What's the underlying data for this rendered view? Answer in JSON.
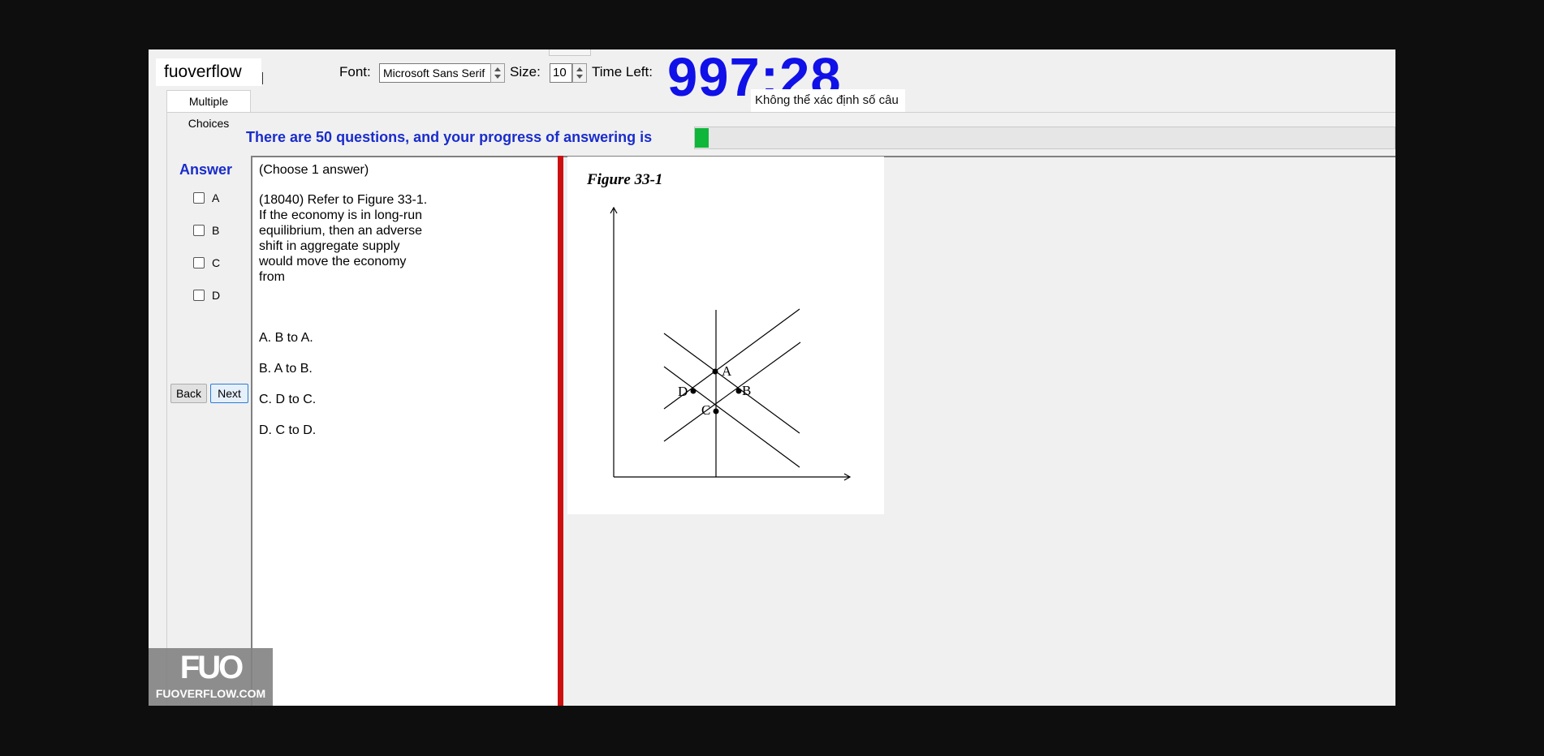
{
  "app": {
    "username": "fuoverflow",
    "font_label": "Font:",
    "font_value": "Microsoft Sans Serif",
    "size_label": "Size:",
    "size_value": "10",
    "time_left_label": "Time Left:",
    "timer": "997:28",
    "status_text": "Không thể xác định số câu"
  },
  "tabs": [
    {
      "label": "Multiple Choices",
      "active": true
    }
  ],
  "progress": {
    "text": "There are 50 questions, and your progress of answering is",
    "fraction": 0.02,
    "color": "#0eb63a"
  },
  "answer": {
    "title": "Answer",
    "options": [
      {
        "label": "A",
        "checked": false
      },
      {
        "label": "B",
        "checked": false
      },
      {
        "label": "C",
        "checked": false
      },
      {
        "label": "D",
        "checked": false
      }
    ],
    "back_label": "Back",
    "next_label": "Next"
  },
  "question": {
    "instruction": "(Choose 1 answer)",
    "lines": [
      "(18040)  Refer to Figure 33-1.",
      "If the economy is in long-run",
      "equilibrium, then an adverse",
      "shift in aggregate supply",
      "would move the economy",
      "from"
    ],
    "choices": [
      "A.  B to A.",
      "B.  A to B.",
      "C.  D to C.",
      "D.  C to D."
    ]
  },
  "figure": {
    "title": "Figure 33-1",
    "points": [
      "A",
      "B",
      "C",
      "D"
    ]
  },
  "watermark": {
    "logo": "FUO",
    "site": "FUOVERFLOW.COM"
  }
}
